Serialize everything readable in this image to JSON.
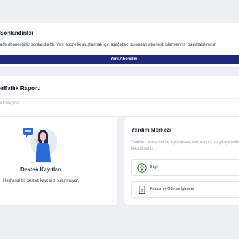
{
  "subscription": {
    "title": "Sonlandırıldı",
    "description": "nde aboneliğiniz sonlandırıldı. Yeni abonelik oluşturmak için aşağıdaki butondan abonelik işlemlerinizi başlatabilirsiniz.",
    "button_label": "Yeni Abonelik",
    "button_color": "#1e2a78"
  },
  "transparency_report": {
    "title": "effaflık Raporu",
    "link_text": "n tıklayınız"
  },
  "support_records": {
    "title": "Destek Kayıtları",
    "empty_text": "Herhangi bir destek kaydınız bulunmuyor.",
    "illustration": "woman-with-chat-bubble-icon"
  },
  "help_center": {
    "title": "Yardım Merkezi",
    "description": "TurkNet hizmetleri ile ilgili destek taleplerinizi ve şikayetlerinizi iletebilirsiniz.",
    "items": [
      {
        "label": "Bilgi",
        "icon": "info-bulb-icon"
      },
      {
        "label": "Fatura ve Ödeme İşlemleri",
        "icon": "invoice-icon"
      }
    ],
    "accent_color": "#2e6b3e"
  }
}
